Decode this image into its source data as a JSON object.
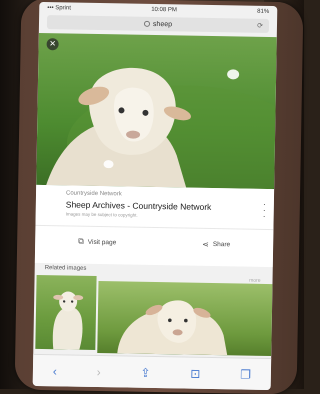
{
  "status": {
    "left": "••• Sprint",
    "time": "10:08 PM",
    "battery": "81%"
  },
  "urlbar": {
    "query": "sheep"
  },
  "card": {
    "source": "Countryside Network",
    "title": "Sheep Archives - Countryside Network",
    "subtitle": "Images may be subject to copyright."
  },
  "actions": {
    "visit": "Visit page",
    "share": "Share"
  },
  "related": {
    "header": "Related images",
    "more": "more"
  },
  "icons": [
    "close-icon",
    "lock-icon",
    "refresh-icon",
    "more-icon",
    "visit-icon",
    "share-icon",
    "back-icon",
    "forward-icon",
    "share-toolbar-icon",
    "bookmarks-icon",
    "tabs-icon"
  ]
}
